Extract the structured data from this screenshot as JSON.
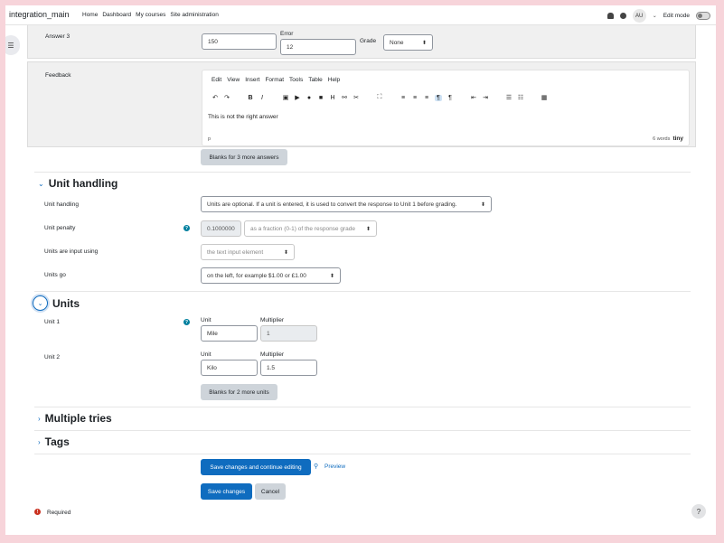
{
  "navbar": {
    "brand": "integration_main",
    "links": [
      "Home",
      "Dashboard",
      "My courses",
      "Site administration"
    ],
    "avatar": "AU",
    "edit_mode": "Edit mode",
    "icons": [
      "bell-icon",
      "chat-icon"
    ]
  },
  "answer3": {
    "label": "Answer 3",
    "value": "150",
    "error_label": "Error",
    "error_value": "12",
    "grade_label": "Grade",
    "grade_value": "None"
  },
  "feedback": {
    "label": "Feedback",
    "menu": [
      "Edit",
      "View",
      "Insert",
      "Format",
      "Tools",
      "Table",
      "Help"
    ],
    "content": "This is not the right answer",
    "path": "p",
    "word_count": "6 words",
    "brand": "tiny"
  },
  "blanks_answers_button": "Blanks for 3 more answers",
  "unit_handling": {
    "title": "Unit handling",
    "handling_label": "Unit handling",
    "handling_value": "Units are optional. If a unit is entered, it is used to convert the response to Unit 1 before grading.",
    "penalty_label": "Unit penalty",
    "penalty_value": "0.1000000",
    "penalty_mode": "as a fraction (0-1) of the response grade",
    "input_label": "Units are input using",
    "input_value": "the text input element",
    "go_label": "Units go",
    "go_value": "on the left, for example $1.00 or £1.00"
  },
  "units": {
    "title": "Units",
    "unit_col": "Unit",
    "multiplier_col": "Multiplier",
    "rows": [
      {
        "label": "Unit 1",
        "unit": "Mile",
        "multiplier": "1"
      },
      {
        "label": "Unit 2",
        "unit": "Kilo",
        "multiplier": "1.5"
      }
    ],
    "blanks_button": "Blanks for 2 more units"
  },
  "sections": {
    "multiple_tries": "Multiple tries",
    "tags": "Tags"
  },
  "actions": {
    "save_continue": "Save changes and continue editing",
    "preview": "Preview",
    "save": "Save changes",
    "cancel": "Cancel"
  },
  "required": "Required",
  "colors": {
    "primary": "#0f6cbf",
    "help": "#00809f",
    "required": "#ca3120",
    "background": "#f7d4da"
  }
}
